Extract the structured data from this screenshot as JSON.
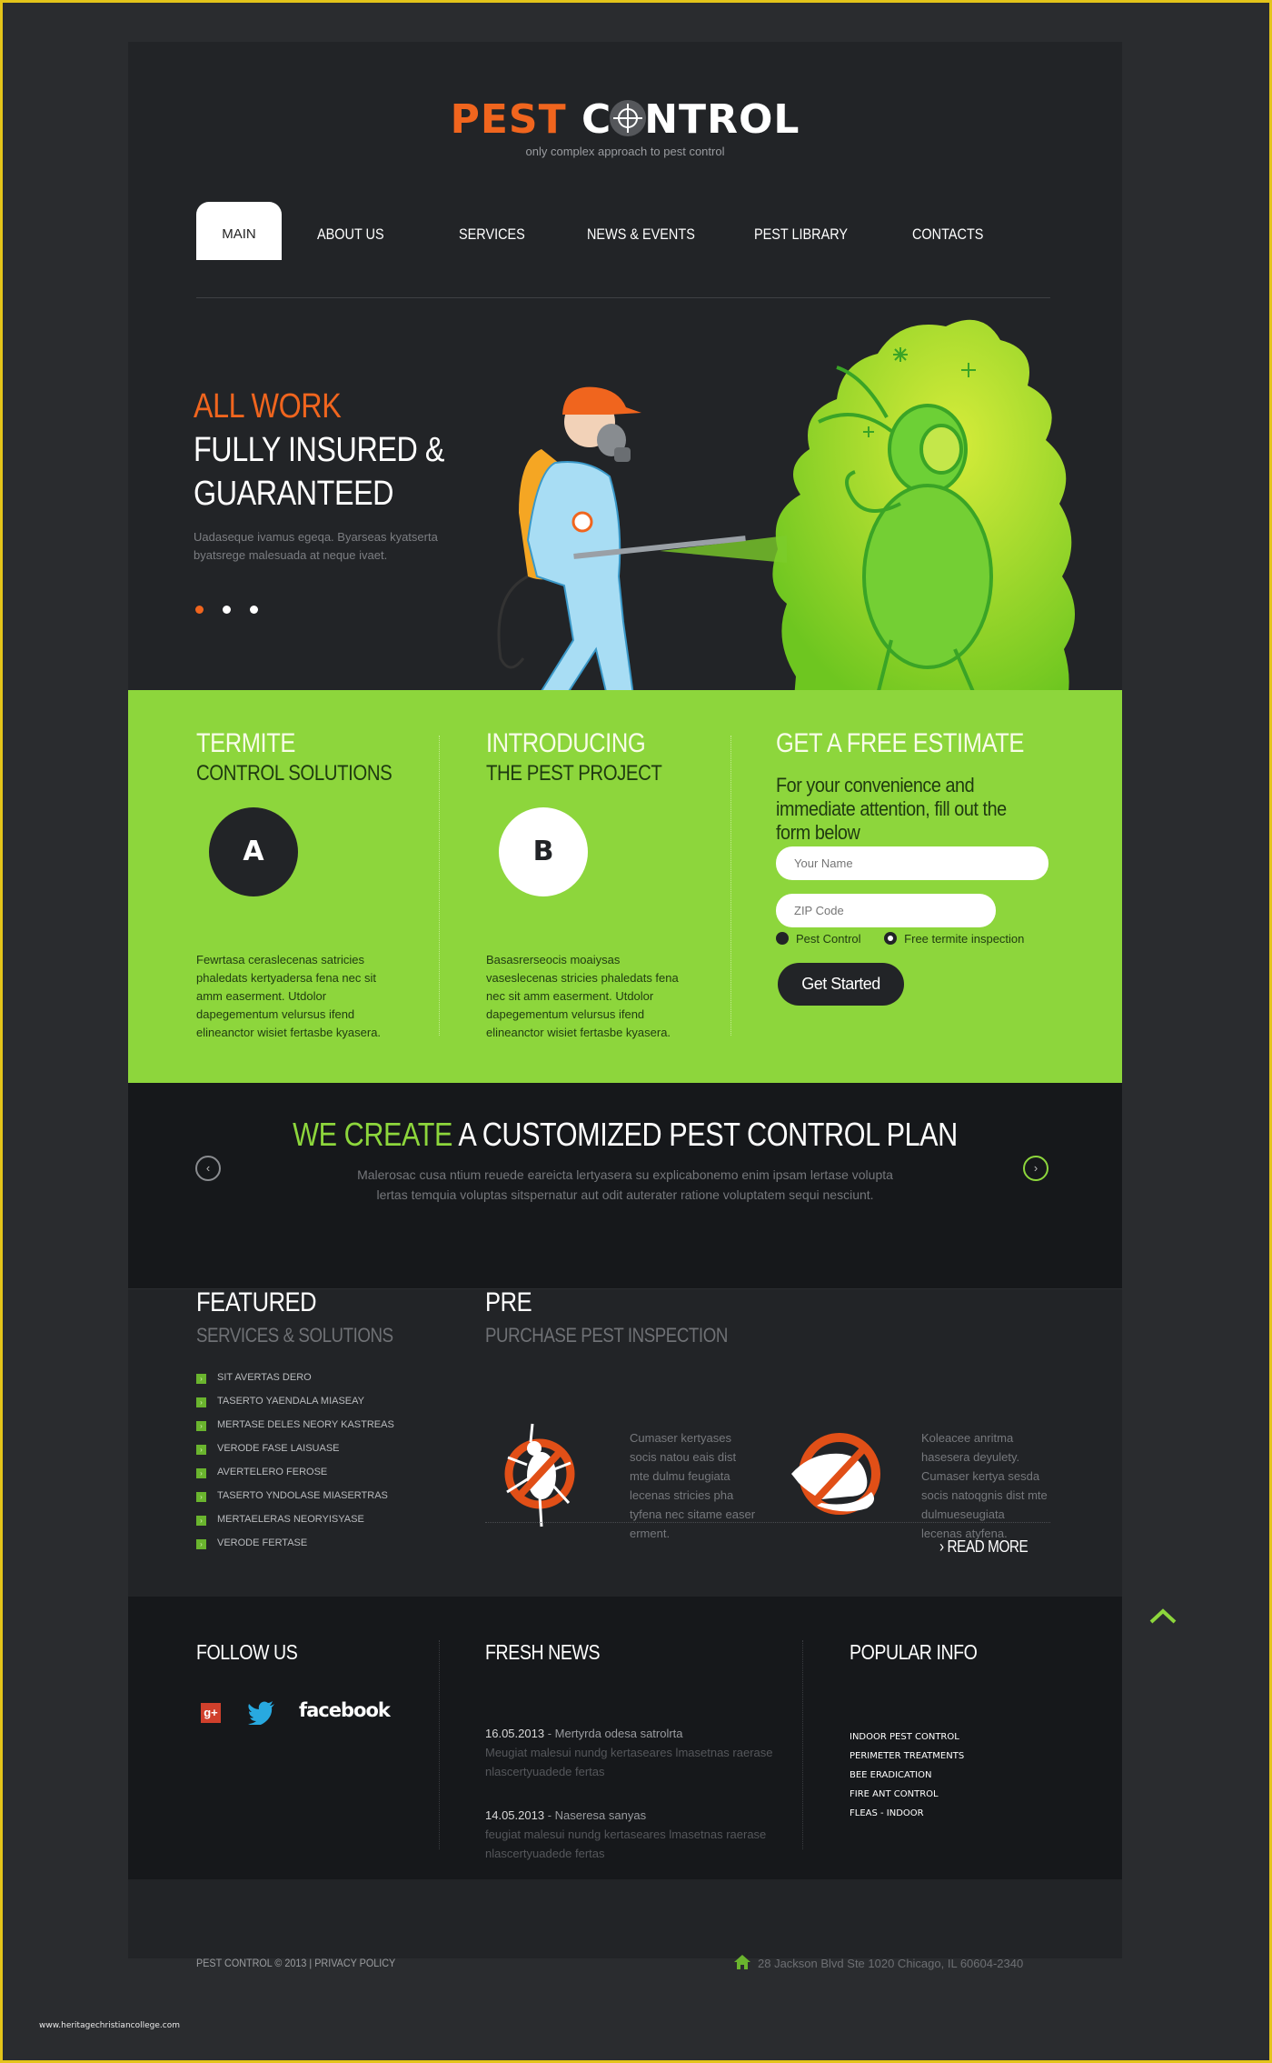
{
  "header": {
    "logo_pest": "PEST",
    "logo_c": "C",
    "logo_rest": "NTROL",
    "tagline": "only complex approach to pest control"
  },
  "nav": {
    "items": [
      {
        "label": "MAIN",
        "active": true
      },
      {
        "label": "ABOUT US"
      },
      {
        "label": "SERVICES"
      },
      {
        "label": "NEWS & EVENTS"
      },
      {
        "label": "PEST LIBRARY"
      },
      {
        "label": "CONTACTS"
      }
    ]
  },
  "hero": {
    "line1": "ALL WORK",
    "line2": "FULLY INSURED &",
    "line3": "GUARANTEED",
    "text": "Uadaseque ivamus egeqa. Byarseas kyatserta byatsrege malesuada at neque ivaet.",
    "slides": 3,
    "active_slide": 1
  },
  "features": [
    {
      "title": "TERMITE",
      "subtitle": "CONTROL SOLUTIONS",
      "badge": "A",
      "text": "Fewrtasa ceraslecenas satricies phaledats kertyadersa fena nec sit amm easerment. Utdolor dapegementum velursus ifend elineanctor wisiet fertasbe kyasera."
    },
    {
      "title": "INTRODUCING",
      "subtitle": "THE PEST PROJECT",
      "badge": "B",
      "text": "Basasrerseocis moaiysas vaseslecenas stricies phaledats fena nec sit amm easerment. Utdolor dapegementum velursus ifend elineanctor wisiet fertasbe kyasera."
    }
  ],
  "estimate": {
    "title": "GET A FREE ESTIMATE",
    "text": "For your convenience and immediate attention, fill out the form below",
    "name_placeholder": "Your Name",
    "zip_placeholder": "ZIP Code",
    "radio1": "Pest Control",
    "radio2": "Free termite inspection",
    "button": "Get Started"
  },
  "plan": {
    "title_green": "WE CREATE",
    "title_white": " A CUSTOMIZED PEST CONTROL PLAN",
    "text": "Malerosac cusa ntium reuede eareicta lertyasera su explicabonemo enim ipsam lertase volupta lertas temquia voluptas sitspernatur aut odit auterater ratione voluptatem sequi nesciunt.",
    "prev": "‹",
    "next": "›"
  },
  "featured": {
    "title": "FEATURED",
    "subtitle": "SERVICES & SOLUTIONS",
    "items": [
      "SIT AVERTAS DERO",
      "TASERTO YAENDALA MIASEAY",
      "MERTASE DELES NEORY KASTREAS",
      "VERODE FASE LAISUASE",
      "AVERTELERO FEROSE",
      "TASERTO YNDOLASE MIASERTRAS",
      "MERTAELERAS NEORYISYASE",
      "VERODE FERTASE"
    ]
  },
  "pre": {
    "title": "PRE",
    "subtitle": "PURCHASE PEST INSPECTION",
    "text1": "Cumaser kertyases socis natou eais dist mte dulmu feugiata lecenas stricies pha tyfena nec sitame easer erment.",
    "text2": "Koleacee anritma hasesera deyulety. Cumaser kertya sesda socis natoqgnis dist mte dulmueseugiata lecenas atyfena.",
    "read_more": "READ MORE"
  },
  "footer": {
    "follow_title": "FOLLOW US",
    "facebook": "facebook",
    "news_title": "FRESH NEWS",
    "news": [
      {
        "date": "16.05.2013",
        "title": " - Mertyrda odesa satrolrta",
        "text": "Meugiat malesui nundg kertaseares lmasetnas raerase nlascertyuadede fertas"
      },
      {
        "date": "14.05.2013",
        "title": " - Naseresa sanyas",
        "text": "feugiat malesui nundg kertaseares lmasetnas raerase nlascertyuadede fertas"
      }
    ],
    "popular_title": "POPULAR INFO",
    "popular": [
      "INDOOR PEST CONTROL",
      "PERIMETER TREATMENTS",
      "BEE ERADICATION",
      "FIRE ANT CONTROL",
      "FLEAS - INDOOR"
    ],
    "copyright": "PEST CONTROL © 2013  |  PRIVACY POLICY",
    "address": "28 Jackson Blvd Ste 1020 Chicago, IL 60604-2340"
  },
  "watermark": "www.heritagechristiancollege.com",
  "colors": {
    "accent_orange": "#f0651e",
    "accent_green": "#8dd63c",
    "dark": "#222427"
  }
}
